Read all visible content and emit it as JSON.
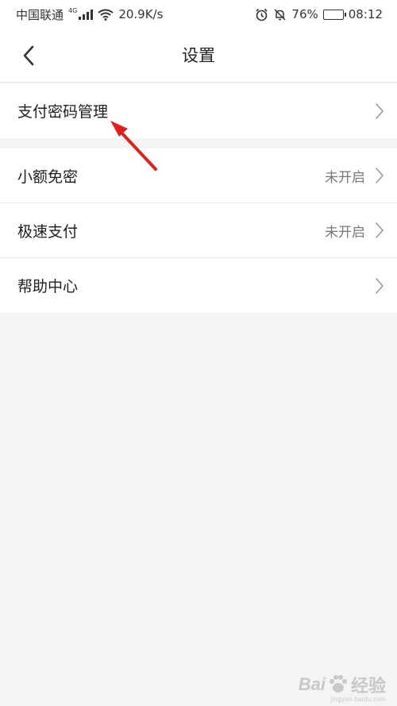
{
  "status_bar": {
    "carrier": "中国联通",
    "network": "4G",
    "speed": "20.9K/s",
    "battery": "76%",
    "battery_level": 0.76,
    "time": "08:12"
  },
  "nav": {
    "title": "设置",
    "back_icon": "chevron-left-icon"
  },
  "groups": [
    {
      "items": [
        {
          "label": "支付密码管理",
          "value": ""
        }
      ]
    },
    {
      "items": [
        {
          "label": "小额免密",
          "value": "未开启"
        },
        {
          "label": "极速支付",
          "value": "未开启"
        },
        {
          "label": "帮助中心",
          "value": ""
        }
      ]
    }
  ],
  "annotation": {
    "color": "#e0211b"
  },
  "watermark": {
    "brand": "Bai",
    "sub": "经验",
    "url": "jingyan.baidu.com"
  },
  "colors": {
    "background": "#f4f4f4",
    "surface": "#ffffff",
    "divider": "#e9e9e9",
    "secondary_text": "#777777"
  }
}
